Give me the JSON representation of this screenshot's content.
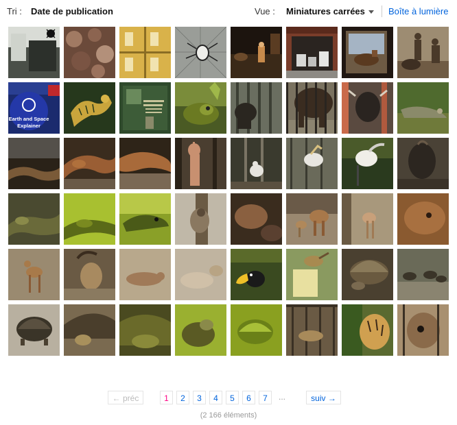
{
  "toolbar": {
    "sort_label": "Tri :",
    "sort_value": "Date de publication",
    "view_label": "Vue :",
    "view_value": "Miniatures carrées",
    "lightbox_label": "Boîte à lumière"
  },
  "pagination": {
    "prev_label": "← préc",
    "pages": [
      "1",
      "2",
      "3",
      "4",
      "5",
      "6",
      "7"
    ],
    "current_page": "1",
    "ellipsis": "...",
    "next_label": "suiv →"
  },
  "item_count": "(2 166 éléments)",
  "colors": {
    "link": "#0063dc",
    "current_page": "#ff0084",
    "disabled": "#bbbbbb"
  },
  "thumbnails": {
    "row1": [
      "dark-room-spider",
      "caterpillar-texture",
      "yellow-room-grid",
      "spider-web",
      "zoo-exhibit-dark",
      "storage-container",
      "diorama-boar",
      "bronze-statues"
    ],
    "row2": [
      "earth-space-badge",
      "gold-tiger-book",
      "green-book-cover",
      "green-frog",
      "dark-animal-bars",
      "bison-fence",
      "wildebeest-fence",
      "green-lizard"
    ],
    "row3": [
      "snake-dark",
      "copper-snake",
      "snake-branch",
      "llama-bars",
      "bird-tree",
      "white-bird-bars",
      "marabou-stork",
      "dark-bird-feathers"
    ],
    "row4": [
      "komodo-dragon",
      "green-lizard-bright",
      "green-lizard-eye",
      "sloth-tree",
      "dark-blur",
      "goats-pair",
      "goat-kid",
      "animal-closeup"
    ],
    "row5": [
      "deer-standing",
      "ibex-horns",
      "kangaroo-lying",
      "lying-animals",
      "toucan",
      "yellow-bird-glass",
      "tortoise-back",
      "tortoises-row"
    ],
    "row6": [
      "tortoise-ground",
      "tortoise-shell",
      "tortoise-dark",
      "tortoise-green",
      "turtle-green",
      "cage-animal",
      "tiger-enclosure",
      "cow-bars"
    ]
  }
}
